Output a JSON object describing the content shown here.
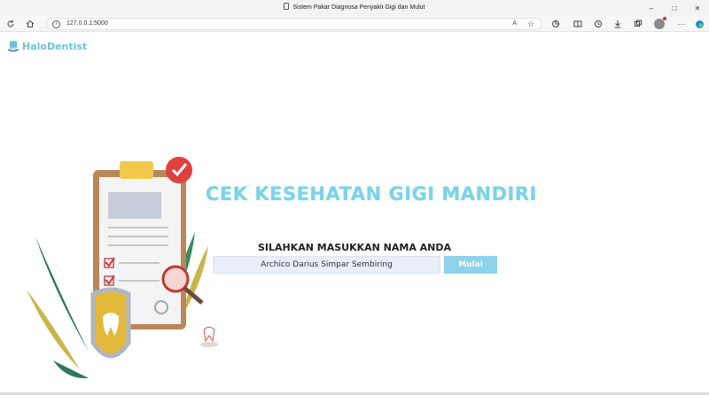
{
  "browser": {
    "window_title": "Sistem Pakar Diagnosa Penyakit Gigi dan Mulut",
    "url": "127.0.0.1:5000",
    "controls": {
      "minimize": "–",
      "maximize": "□",
      "close": "✕"
    },
    "toolbar_icons": [
      "reload-icon",
      "home-icon",
      "info-icon",
      "read-aloud-icon",
      "favorite-icon",
      "extensions-icon",
      "split-screen-icon",
      "history-icon",
      "downloads-icon",
      "collections-icon",
      "profile-icon",
      "more-icon",
      "edge-icon"
    ]
  },
  "page": {
    "logo": {
      "text": "HaloDentist",
      "color": "#6cc3d9"
    },
    "hero_title": "CEK KESEHATAN GIGI MANDIRI",
    "prompt": "SILAHKAN MASUKKAN NAMA ANDA",
    "name_input": {
      "value": "Archico Darius Simpar Sembiring"
    },
    "start_button": "Mulai"
  },
  "colors": {
    "accent": "#7dd3e6",
    "button": "#8fd3ea",
    "input_bg": "#e9eefa"
  }
}
